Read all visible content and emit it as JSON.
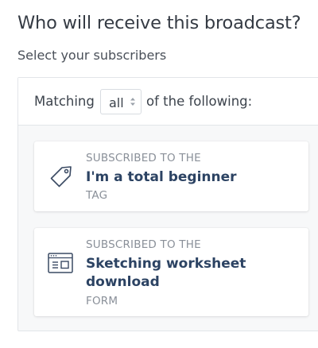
{
  "header": {
    "title": "Who will receive this broadcast?",
    "subtitle": "Select your subscribers"
  },
  "filter": {
    "prefix": "Matching",
    "selected": "all",
    "suffix": "of the following:"
  },
  "conditions": [
    {
      "qualifier": "SUBSCRIBED TO THE",
      "name": "I'm a total beginner",
      "type": "TAG",
      "icon": "tag-icon"
    },
    {
      "qualifier": "SUBSCRIBED TO THE",
      "name": "Sketching worksheet download",
      "type": "FORM",
      "icon": "form-icon"
    }
  ],
  "colors": {
    "accent_text": "#2c4363",
    "muted_text": "#8a9099",
    "icon_stroke": "#3a4a63"
  }
}
